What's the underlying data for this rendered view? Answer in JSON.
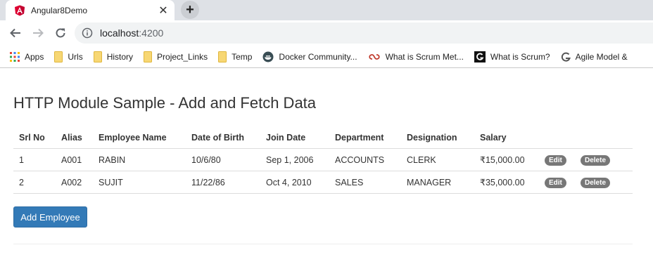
{
  "browser": {
    "tab_title": "Angular8Demo",
    "url_host": "localhost",
    "url_port": ":4200",
    "colors": {
      "tabstrip": "#dee1e6",
      "favicon": "#dd0031"
    }
  },
  "bookmarks": [
    {
      "label": "Apps",
      "icon": "apps-grid-icon"
    },
    {
      "label": "Urls",
      "icon": "folder-icon"
    },
    {
      "label": "History",
      "icon": "folder-icon"
    },
    {
      "label": "Project_Links",
      "icon": "folder-icon"
    },
    {
      "label": "Temp",
      "icon": "folder-icon"
    },
    {
      "label": "Docker Community...",
      "icon": "docker-icon"
    },
    {
      "label": "What is Scrum Met...",
      "icon": "scrum-link-icon"
    },
    {
      "label": "What is Scrum?",
      "icon": "g-logo-icon"
    },
    {
      "label": "Agile Model &",
      "icon": "g-swirl-icon"
    }
  ],
  "page": {
    "title": "HTTP Module Sample - Add and Fetch Data",
    "columns": [
      "Srl No",
      "Alias",
      "Employee Name",
      "Date of Birth",
      "Join Date",
      "Department",
      "Designation",
      "Salary"
    ],
    "rows": [
      [
        "1",
        "A001",
        "RABIN",
        "10/6/80",
        "Sep 1, 2006",
        "ACCOUNTS",
        "CLERK",
        "₹15,000.00"
      ],
      [
        "2",
        "A002",
        "SUJIT",
        "11/22/86",
        "Oct 4, 2010",
        "SALES",
        "MANAGER",
        "₹35,000.00"
      ]
    ],
    "edit_label": "Edit",
    "delete_label": "Delete",
    "add_label": "Add Employee",
    "colors": {
      "primary": "#337ab7",
      "badge": "#777777"
    }
  }
}
